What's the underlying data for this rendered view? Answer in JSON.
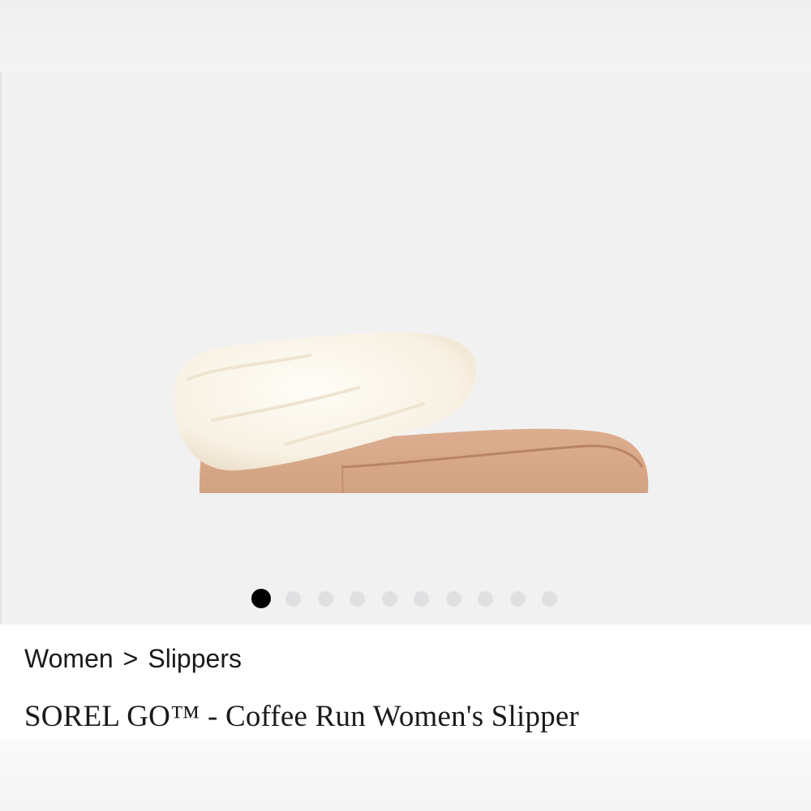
{
  "gallery": {
    "image_alt": "SOREL GO - Coffee Run Women's Slipper",
    "dots_total": 10,
    "active_index": 0,
    "colors": {
      "background": "#f1f1f2",
      "dot_active": "#000000",
      "dot_inactive": "#e0e0e2",
      "suede": "#d7a98a",
      "fur": "#fbf6ec",
      "sole": "#a0633e"
    }
  },
  "breadcrumb": {
    "items": [
      {
        "label": "Women"
      },
      {
        "label": "Slippers"
      }
    ],
    "separator": ">"
  },
  "product": {
    "title": "SOREL GO™ - Coffee Run Women's Slipper"
  }
}
